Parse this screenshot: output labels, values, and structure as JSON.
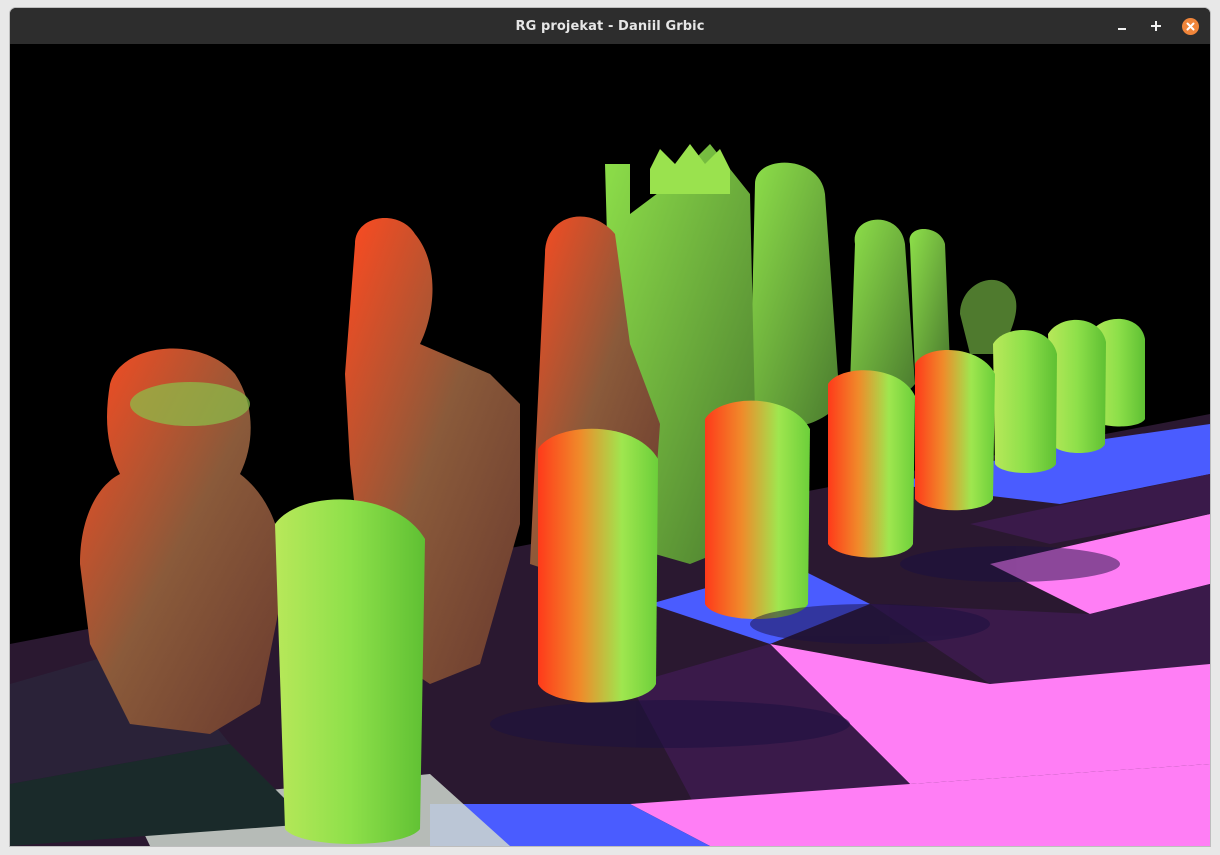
{
  "window": {
    "title": "RG projekat - Daniil Grbic",
    "controls": {
      "minimize_icon": "minimize-icon",
      "maximize_icon": "maximize-icon",
      "close_icon": "close-icon",
      "close_color": "#f0853a"
    }
  },
  "scene": {
    "background": "#000000",
    "board_colors": [
      "#ff7ef5",
      "#3a1a4a",
      "#4a5cff"
    ],
    "piece_colors": {
      "lit_green": "#7ee04a",
      "lit_red": "#ff3a1a",
      "lit_orange": "#f08a2a"
    }
  }
}
